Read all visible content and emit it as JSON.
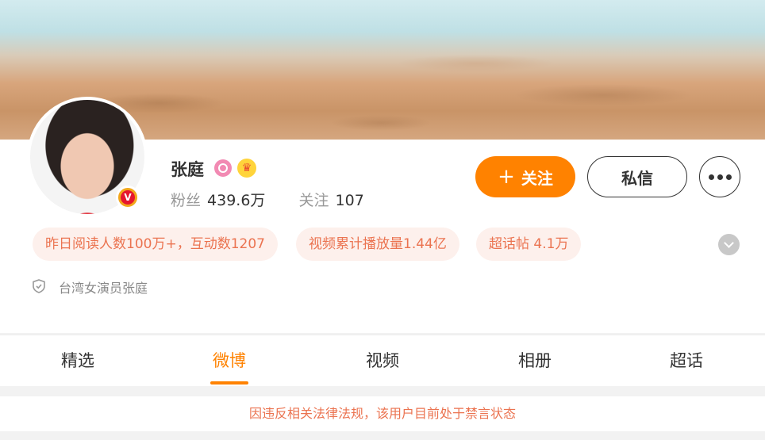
{
  "profile": {
    "name": "张庭",
    "verified_mark": "V",
    "stats": {
      "fans_label": "粉丝",
      "fans_value": "439.6万",
      "following_label": "关注",
      "following_value": "107"
    },
    "description": "台湾女演员张庭"
  },
  "actions": {
    "follow_plus": "+",
    "follow_label": "关注",
    "message_label": "私信"
  },
  "tags": [
    {
      "text": "昨日阅读人数100万+，互动数1207"
    },
    {
      "text": "视频累计播放量1.44亿"
    },
    {
      "text": "超话帖 4.1万"
    }
  ],
  "tabs": [
    {
      "label": "精选"
    },
    {
      "label": "微博"
    },
    {
      "label": "视频"
    },
    {
      "label": "相册"
    },
    {
      "label": "超话"
    }
  ],
  "active_tab": "微博",
  "notice": "因违反相关法律法规，该用户目前处于禁言状态",
  "colors": {
    "accent": "#ff8200",
    "tag_text": "#eb7350",
    "tag_bg": "#fdf0ec"
  },
  "icons": [
    "level-icon",
    "crown-icon",
    "shield-icon",
    "verified-badge",
    "more-dots-icon",
    "expand-chevron-icon"
  ]
}
